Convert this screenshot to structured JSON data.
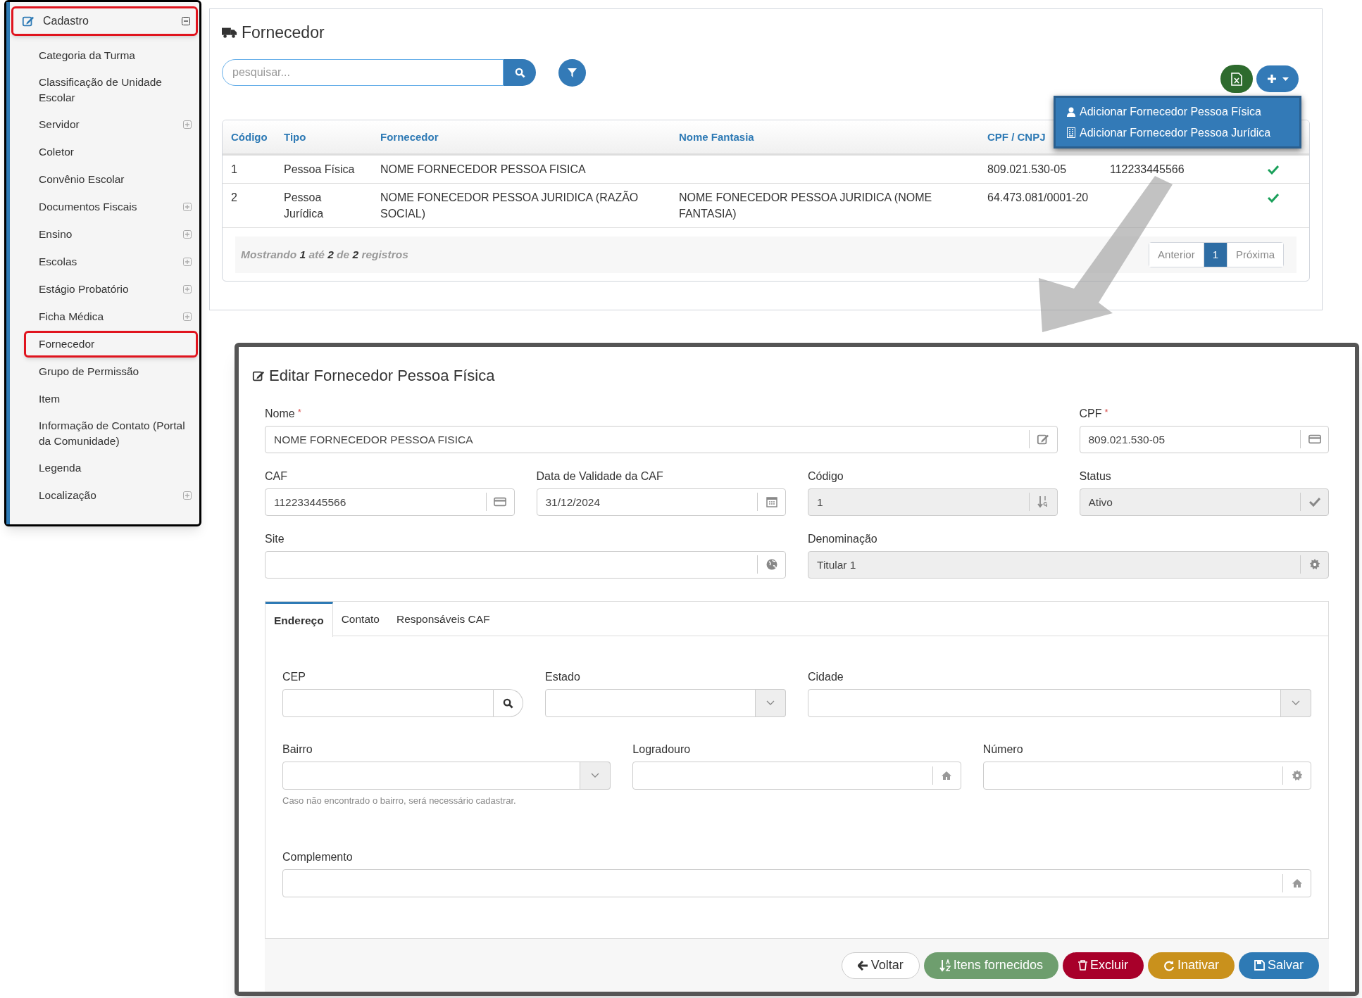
{
  "sidebar": {
    "header": {
      "label": "Cadastro",
      "expanded": true,
      "highlighted": true
    },
    "items": [
      {
        "label": "Categoria da Turma",
        "has_children": false,
        "highlighted": false
      },
      {
        "label": "Classificação de Unidade Escolar",
        "has_children": false,
        "highlighted": false
      },
      {
        "label": "Servidor",
        "has_children": true,
        "highlighted": false
      },
      {
        "label": "Coletor",
        "has_children": false,
        "highlighted": false
      },
      {
        "label": "Convênio Escolar",
        "has_children": false,
        "highlighted": false
      },
      {
        "label": "Documentos Fiscais",
        "has_children": true,
        "highlighted": false
      },
      {
        "label": "Ensino",
        "has_children": true,
        "highlighted": false
      },
      {
        "label": "Escolas",
        "has_children": true,
        "highlighted": false
      },
      {
        "label": "Estágio Probatório",
        "has_children": true,
        "highlighted": false
      },
      {
        "label": "Ficha Médica",
        "has_children": true,
        "highlighted": false
      },
      {
        "label": "Fornecedor",
        "has_children": false,
        "highlighted": true
      },
      {
        "label": "Grupo de Permissão",
        "has_children": false,
        "highlighted": false
      },
      {
        "label": "Item",
        "has_children": false,
        "highlighted": false
      },
      {
        "label": "Informação de Contato (Portal da Comunidade)",
        "has_children": false,
        "highlighted": false
      },
      {
        "label": "Legenda",
        "has_children": false,
        "highlighted": false
      },
      {
        "label": "Localização",
        "has_children": true,
        "highlighted": false
      }
    ]
  },
  "supplier_list": {
    "title": "Fornecedor",
    "search": {
      "placeholder": "pesquisar..."
    },
    "add_menu": {
      "open": true,
      "items": [
        {
          "label": "Adicionar Fornecedor Pessoa Física",
          "kind": "person"
        },
        {
          "label": "Adicionar Fornecedor Pessoa Jurídica",
          "kind": "company"
        }
      ]
    },
    "table": {
      "columns": [
        "Código",
        "Tipo",
        "Fornecedor",
        "Nome Fantasia",
        "CPF / CNPJ"
      ],
      "rows": [
        {
          "codigo": "1",
          "tipo": "Pessoa Física",
          "fornecedor": "NOME FORNECEDOR PESSOA FISICA",
          "cpf_cnpj": "809.021.530-05",
          "column_6": "112233445566",
          "active": true
        },
        {
          "codigo": "2",
          "tipo": "Pessoa Jurídica",
          "fornecedor": "NOME FONECEDOR PESSOA JURIDICA (RAZÃO SOCIAL)",
          "nome_fantasia": "NOME FONECEDOR PESSOA JURIDICA (NOME FANTASIA)",
          "cpf_cnpj": "64.473.081/0001-20",
          "active": true
        }
      ]
    },
    "summary": "Mostrando **1** até **2** de **2** registros",
    "pagination": [
      {
        "label": "Anterior",
        "selected": false
      },
      {
        "label": "1",
        "selected": true
      },
      {
        "label": "Próxima",
        "selected": false
      }
    ]
  },
  "edit_form": {
    "title": "Editar Fornecedor Pessoa Física",
    "fields": [
      {
        "label": "Nome",
        "required_mark": "*",
        "value": "NOME FORNECEDOR PESSOA FISICA",
        "disabled": false
      },
      {
        "label": "CPF",
        "required_mark": "*",
        "value": "809.021.530-05",
        "disabled": false
      },
      {
        "label": "CAF",
        "value": "112233445566",
        "disabled": false
      },
      {
        "label": "Data de Validade da CAF",
        "value": "31/12/2024",
        "disabled": false
      },
      {
        "label": "Código",
        "value": "1",
        "disabled": true
      },
      {
        "label": "Status",
        "value": "Ativo",
        "disabled": true
      },
      {
        "label": "Site",
        "disabled": false
      },
      {
        "label": "Denominação",
        "value": "Titular 1",
        "disabled": true
      }
    ],
    "tabs": [
      {
        "label": "Endereço",
        "selected": true
      },
      {
        "label": "Contato",
        "selected": false
      },
      {
        "label": "Responsáveis CAF",
        "selected": false
      }
    ],
    "address_fields": [
      {
        "label": "CEP",
        "kind": "search"
      },
      {
        "label": "Estado",
        "kind": "select"
      },
      {
        "label": "Cidade",
        "kind": "select"
      },
      {
        "label": "Bairro",
        "kind": "select",
        "help": "Caso não encontrado o bairro, será necessário cadastrar."
      },
      {
        "label": "Logradouro",
        "kind": "text"
      },
      {
        "label": "Número",
        "kind": "text"
      },
      {
        "label": "Complemento",
        "kind": "text"
      }
    ],
    "buttons": [
      {
        "label": "Voltar",
        "kind": "back"
      },
      {
        "label": "Itens fornecidos",
        "kind": "items"
      },
      {
        "label": "Excluir",
        "kind": "delete"
      },
      {
        "label": "Inativar",
        "kind": "inactivate"
      },
      {
        "label": "Salvar",
        "kind": "save"
      }
    ]
  }
}
